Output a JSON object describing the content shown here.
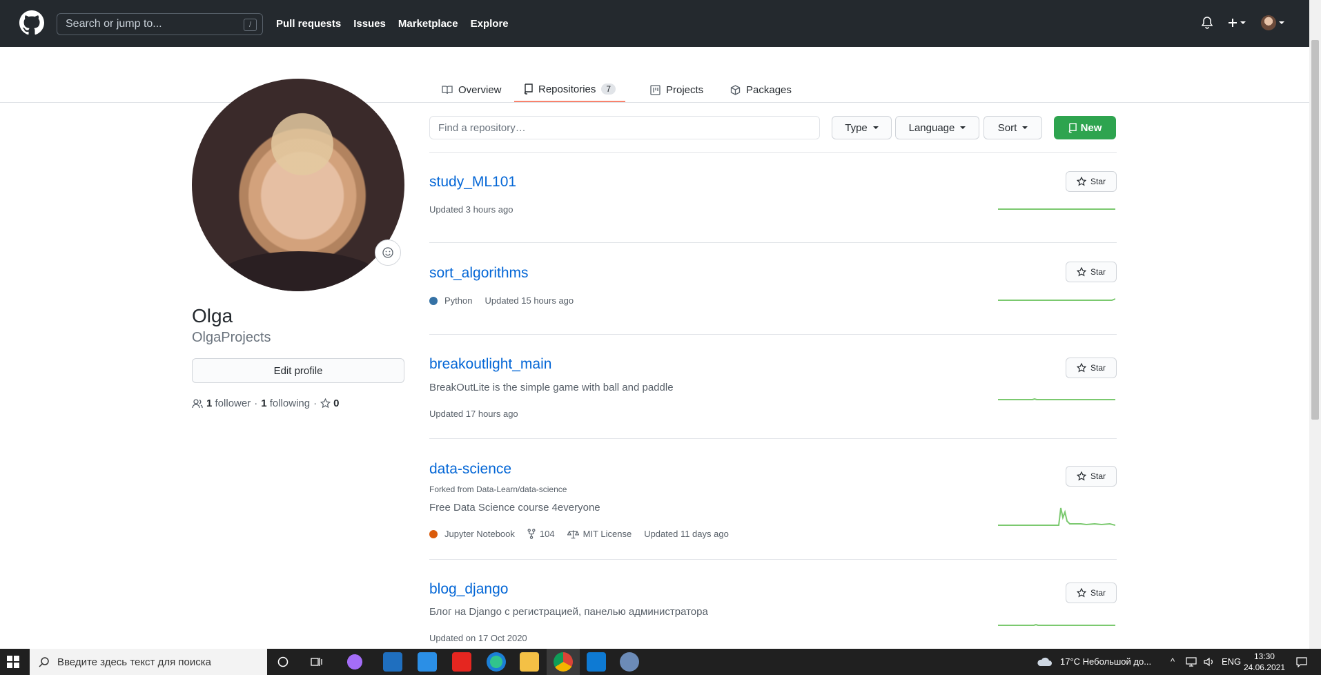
{
  "header": {
    "search_placeholder": "Search or jump to...",
    "search_shortcut": "/",
    "nav": [
      "Pull requests",
      "Issues",
      "Marketplace",
      "Explore"
    ]
  },
  "tabs": [
    {
      "label": "Overview"
    },
    {
      "label": "Repositories",
      "count": "7"
    },
    {
      "label": "Projects"
    },
    {
      "label": "Packages"
    }
  ],
  "profile": {
    "name": "Olga",
    "login": "OlgaProjects",
    "edit_label": "Edit profile",
    "followers": "1",
    "followers_label": "follower",
    "following": "1",
    "following_label": "following",
    "stars": "0"
  },
  "repo_filters": {
    "find_placeholder": "Find a repository…",
    "type_label": "Type",
    "language_label": "Language",
    "sort_label": "Sort",
    "new_label": "New"
  },
  "repos": [
    {
      "name": "study_ML101",
      "updated": "Updated 3 hours ago",
      "star_label": "Star"
    },
    {
      "name": "sort_algorithms",
      "language": "Python",
      "language_color": "#3572A5",
      "updated": "Updated 15 hours ago",
      "star_label": "Star"
    },
    {
      "name": "breakoutlight_main",
      "description": "BreakOutLite is the simple game with ball and paddle",
      "updated": "Updated 17 hours ago",
      "star_label": "Star"
    },
    {
      "name": "data-science",
      "forked_from": "Forked from Data-Learn/data-science",
      "description": "Free Data Science course 4everyone",
      "language": "Jupyter Notebook",
      "language_color": "#DA5B0B",
      "forks": "104",
      "license": "MIT License",
      "updated": "Updated 11 days ago",
      "star_label": "Star"
    },
    {
      "name": "blog_django",
      "description": "Блог на Django с регистрацией, панелью администратора",
      "updated": "Updated on 17 Oct 2020",
      "star_label": "Star"
    }
  ],
  "colors": {
    "header_bg": "#24292e",
    "link": "#0366d6",
    "new_button": "#2ea44f",
    "tab_underline": "#f9826c",
    "sparkline": "#7bc96f"
  },
  "taskbar": {
    "search_placeholder": "Введите здесь текст для поиска",
    "weather": "17°C  Небольшой до...",
    "lang": "ENG",
    "time": "13:30",
    "date": "24.06.2021"
  }
}
